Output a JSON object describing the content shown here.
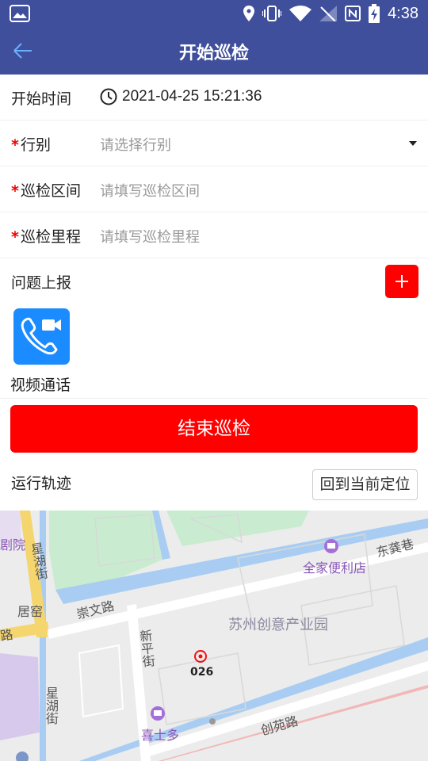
{
  "status_bar": {
    "time": "4:38"
  },
  "header": {
    "title": "开始巡检"
  },
  "form": {
    "start_time": {
      "label": "开始时间",
      "value": "2021-04-25 15:21:36"
    },
    "line_type": {
      "required_mark": "*",
      "label": "行别",
      "placeholder": "请选择行别"
    },
    "section": {
      "required_mark": "*",
      "label": "巡检区间",
      "placeholder": "请填写巡检区间"
    },
    "mileage": {
      "required_mark": "*",
      "label": "巡检里程",
      "placeholder": "请填写巡检里程"
    },
    "issue_report": {
      "label": "问题上报"
    }
  },
  "video_call": {
    "label": "视频通话"
  },
  "end_button": {
    "label": "结束巡检"
  },
  "trajectory": {
    "label": "运行轨迹",
    "locate_button": "回到当前定位"
  },
  "map": {
    "labels": {
      "theater": "剧院",
      "xinghu_st_1": "星湖街",
      "xinghu_st_2": "星湖街",
      "chongwen_rd": "崇文路",
      "road_left": "路",
      "juyao": "居窑",
      "xinping_st": "新平街",
      "family_mart": "全家便利店",
      "dongyi_lane": "东龚巷",
      "creative_park": "苏州创意产业园",
      "marker_number": "026",
      "xishiduo": "喜士多",
      "chuangyuan_rd": "创苑路"
    }
  },
  "colors": {
    "primary": "#3f4f9c",
    "danger": "#ff0000",
    "accent": "#1a8cff"
  }
}
